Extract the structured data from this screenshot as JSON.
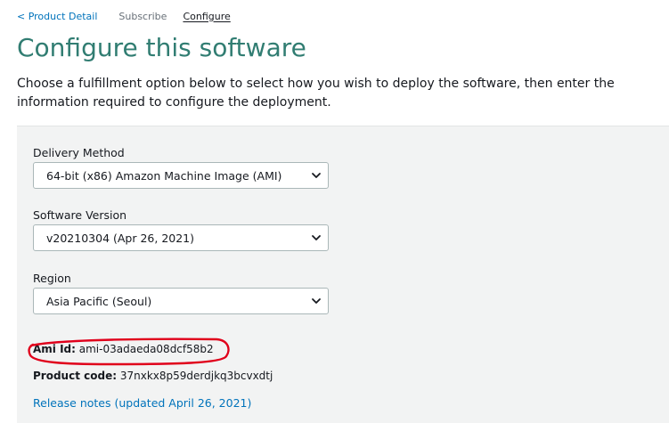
{
  "breadcrumb": {
    "back": "< Product Detail",
    "subscribe": "Subscribe",
    "configure": "Configure"
  },
  "page": {
    "title": "Configure this software",
    "intro": "Choose a fulfillment option below to select how you wish to deploy the software, then enter the information required to configure the deployment."
  },
  "form": {
    "delivery_method": {
      "label": "Delivery Method",
      "value": "64-bit (x86) Amazon Machine Image (AMI)"
    },
    "software_version": {
      "label": "Software Version",
      "value": "v20210304 (Apr 26, 2021)"
    },
    "region": {
      "label": "Region",
      "value": "Asia Pacific (Seoul)"
    }
  },
  "details": {
    "ami_label": "Ami Id:",
    "ami_value": "ami-03adaeda08dcf58b2",
    "product_code_label": "Product code:",
    "product_code_value": "37nxkx8p59derdjkq3bcvxdtj",
    "release_notes": "Release notes (updated April 26, 2021)"
  },
  "icons": {
    "select_chevron": "chevron-down-icon",
    "highlight": "red-freehand-ellipse"
  },
  "colors": {
    "title": "#317d72",
    "link": "#0073bb",
    "panel": "#f2f3f3",
    "highlight": "#e0001b"
  }
}
